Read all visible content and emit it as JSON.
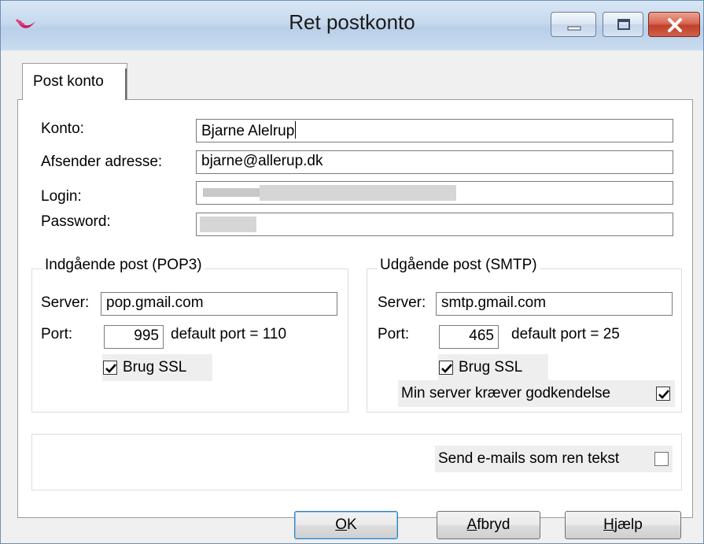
{
  "window": {
    "title": "Ret postkonto"
  },
  "tabs": [
    {
      "label": "Post konto",
      "selected": true
    }
  ],
  "account": {
    "konto_label": "Konto:",
    "konto_value": "Bjarne Alelrup",
    "sender_label": "Afsender adresse:",
    "sender_value": "bjarne@allerup.dk",
    "login_label": "Login:",
    "login_value_redacted": true,
    "password_label": "Password:",
    "password_value_redacted": true
  },
  "incoming": {
    "title": "Indgående post (POP3)",
    "server_label": "Server:",
    "server_value": "pop.gmail.com",
    "port_label": "Port:",
    "port_value": "995",
    "default_port_text": "default port = 110",
    "ssl_label": "Brug SSL",
    "ssl_checked": true
  },
  "outgoing": {
    "title": "Udgående post (SMTP)",
    "server_label": "Server:",
    "server_value": "smtp.gmail.com",
    "port_label": "Port:",
    "port_value": "465",
    "default_port_text": "default port = 25",
    "ssl_label": "Brug SSL",
    "ssl_checked": true,
    "auth_label": "Min server kræver godkendelse",
    "auth_checked": true
  },
  "options": {
    "plain_text_label": "Send e-mails som ren tekst",
    "plain_text_checked": false
  },
  "buttons": {
    "ok_mnemonic": "O",
    "ok_rest": "K",
    "cancel_mnemonic": "A",
    "cancel_rest": "fbryd",
    "help_mnemonic": "H",
    "help_rest": "jælp"
  },
  "colors": {
    "titlebar": "#c6d9ee",
    "close_button": "#c1402a",
    "default_button_border": "#3c7fb1"
  },
  "icons": {
    "app_icon": "app-logo-icon",
    "minimize": "minimize-icon",
    "maximize": "maximize-icon",
    "close": "close-icon",
    "checkmark": "checkmark-icon"
  }
}
